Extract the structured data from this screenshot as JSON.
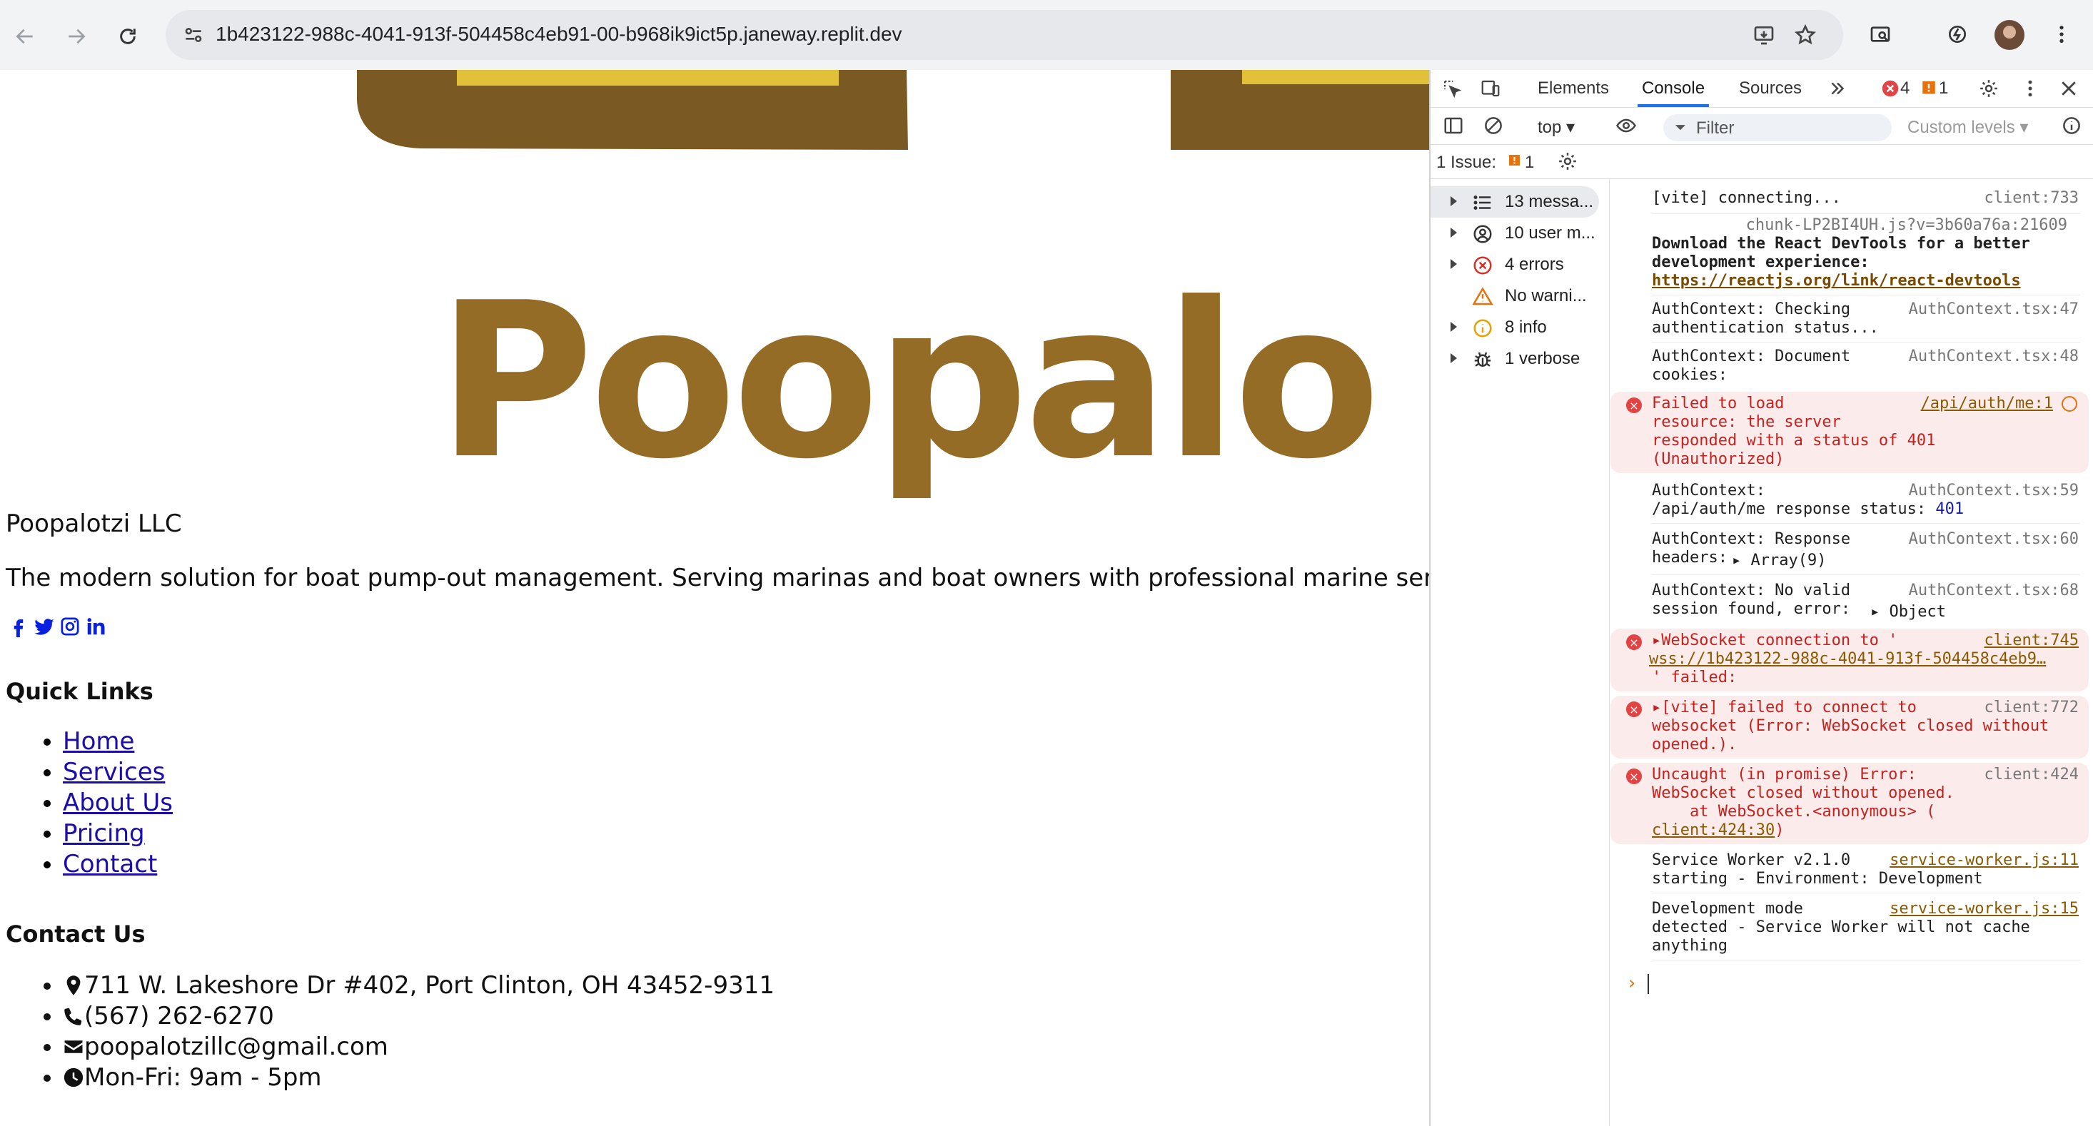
{
  "browser": {
    "url": "1b423122-988c-4041-913f-504458c4eb91-00-b968ik9ict5p.janeway.replit.dev"
  },
  "page": {
    "logo_text": "Poopalo",
    "company": "Poopalotzi LLC",
    "tagline": "The modern solution for boat pump-out management. Serving marinas and boat owners with professional marine services.",
    "social_icons": [
      "facebook-icon",
      "twitter-icon",
      "instagram-icon",
      "linkedin-icon"
    ],
    "quick_links": {
      "heading": "Quick Links",
      "items": [
        "Home",
        "Services",
        "About Us",
        "Pricing",
        "Contact"
      ]
    },
    "contact": {
      "heading": "Contact Us",
      "address": "711 W. Lakeshore Dr #402, Port Clinton, OH 43452-9311",
      "phone": "(567) 262-6270",
      "email": "poopalotzillc@gmail.com",
      "hours": "Mon-Fri: 9am - 5pm"
    },
    "colors": {
      "logo_brown": "#956c26",
      "logo_dark": "#7a5a22",
      "logo_yellow": "#e2c13a",
      "social_blue": "#0a20e0"
    }
  },
  "devtools": {
    "tabs": [
      "Elements",
      "Console",
      "Sources"
    ],
    "active_tab": "Console",
    "error_count": "4",
    "issue_count": "1",
    "context": "top",
    "filter_placeholder": "Filter",
    "levels": "Custom levels",
    "issues_label": "1 Issue:",
    "issues_num": "1",
    "sidebar": [
      {
        "label": "13 messa...",
        "icon": "list-icon"
      },
      {
        "label": "10 user m...",
        "icon": "user-icon"
      },
      {
        "label": "4 errors",
        "icon": "error-icon"
      },
      {
        "label": "No warni...",
        "icon": "warning-icon"
      },
      {
        "label": "8 info",
        "icon": "info-icon"
      },
      {
        "label": "1 verbose",
        "icon": "bug-icon"
      }
    ],
    "messages": {
      "m1": {
        "text": "[vite] connecting...",
        "src": "client:733"
      },
      "m2": {
        "src": "chunk-LP2BI4UH.js?v=3b60a76a:21609",
        "text1": "Download the React DevTools for a better",
        "text2": "development experience:",
        "link": "https://reactjs.org/link/react-devtools"
      },
      "m3": {
        "text1": "AuthContext: Checking",
        "text2": "authentication status...",
        "src": "AuthContext.tsx:47"
      },
      "m4": {
        "text1": "AuthContext: Document",
        "text2": "cookies:",
        "src": "AuthContext.tsx:48"
      },
      "m5": {
        "text1": "Failed to load",
        "text2": "resource: the server",
        "text3": "responded with a status of 401",
        "text4": "(Unauthorized)",
        "src": "/api/auth/me:1"
      },
      "m6": {
        "text1": "AuthContext:",
        "text2": "/api/auth/me response status: ",
        "num": "401",
        "src": "AuthContext.tsx:59"
      },
      "m7": {
        "text1": "AuthContext: Response",
        "text2": "headers:",
        "obj": "Array(9)",
        "src": "AuthContext.tsx:60"
      },
      "m8": {
        "text1": "AuthContext: No valid",
        "text2": "session found, error:",
        "obj": "Object",
        "src": "AuthContext.tsx:68"
      },
      "m9": {
        "text1": "WebSocket connection to '",
        "link": "wss://1b423122-988c-4041-913f-504458c4eb9…",
        "text3": "' failed:",
        "src": "client:745"
      },
      "m10": {
        "text1": "[vite] failed to connect to",
        "text2": "websocket (Error: WebSocket closed without",
        "text3": "opened.).",
        "src": "client:772"
      },
      "m11": {
        "text1": "Uncaught (in promise) Error:",
        "text2": "WebSocket closed without opened.",
        "text3": "    at WebSocket.<anonymous> (",
        "link": "client:424:30",
        "close": ")",
        "src": "client:424"
      },
      "m12": {
        "text1": "Service Worker v2.1.0",
        "text2": "starting - Environment: Development",
        "src": "service-worker.js:11"
      },
      "m13": {
        "text1": "Development mode",
        "text2": "detected - Service Worker will not cache",
        "text3": "anything",
        "src": "service-worker.js:15"
      }
    },
    "prompt": "›"
  }
}
